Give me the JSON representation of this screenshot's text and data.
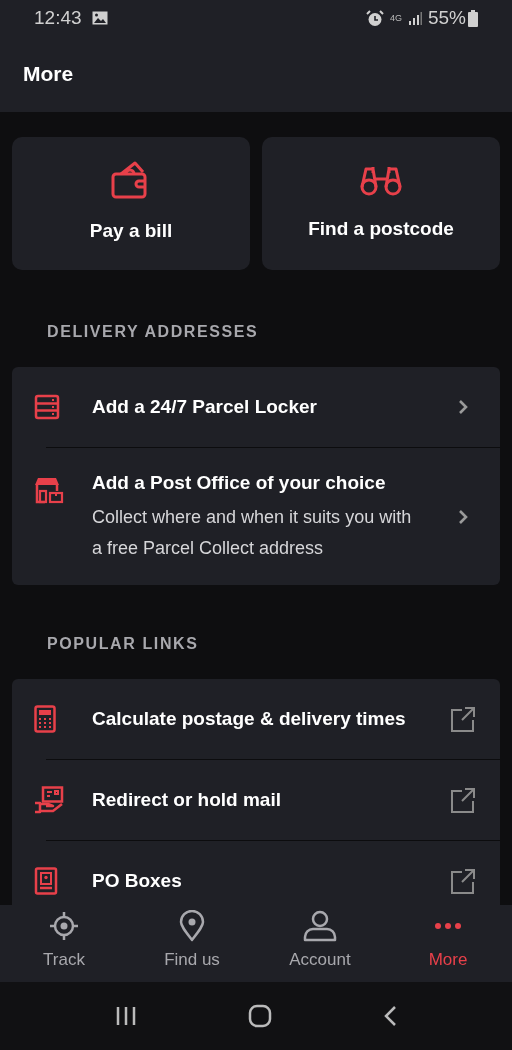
{
  "status_bar": {
    "time": "12:43",
    "network": "4G",
    "battery": "55%"
  },
  "header": {
    "title": "More"
  },
  "tiles": [
    {
      "label": "Pay a bill"
    },
    {
      "label": "Find a postcode"
    }
  ],
  "sections": [
    {
      "heading": "DELIVERY ADDRESSES",
      "rows": [
        {
          "kind": "internal",
          "title": "Add a 24/7 Parcel Locker"
        },
        {
          "kind": "internal",
          "title": "Add a Post Office of your choice",
          "subtitle": "Collect where and when it suits you with a free Parcel Collect address"
        }
      ]
    },
    {
      "heading": "POPULAR LINKS",
      "rows": [
        {
          "kind": "external",
          "title": "Calculate postage & delivery times"
        },
        {
          "kind": "external",
          "title": "Redirect or hold mail"
        },
        {
          "kind": "external",
          "title": "PO Boxes"
        }
      ]
    }
  ],
  "bottom_nav": [
    {
      "label": "Track",
      "selected": false
    },
    {
      "label": "Find us",
      "selected": false
    },
    {
      "label": "Account",
      "selected": false
    },
    {
      "label": "More",
      "selected": true
    }
  ]
}
